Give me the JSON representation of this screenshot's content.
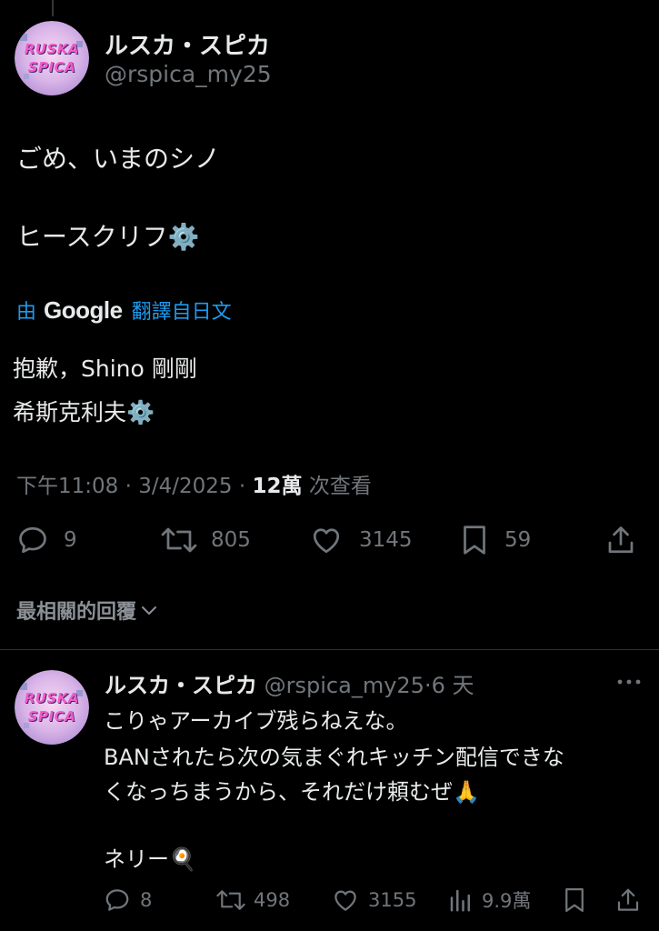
{
  "main_tweet": {
    "display_name": "ルスカ・スピカ",
    "handle": "@rspica_my25",
    "avatar_text": [
      "RUSKA",
      "SPICA"
    ],
    "text_line1": "ごめ、いまのシノ",
    "text_line2": "ヒースクリフ⚙️",
    "translate_prefix": "由",
    "translate_brand": "Google",
    "translate_suffix": "翻譯自日文",
    "translated_line1": "抱歉，Shino 剛剛",
    "translated_line2": "希斯克利夫⚙️",
    "time": "下午11:08",
    "date": "3/4/2025",
    "views_count": "12萬",
    "views_label": "次查看",
    "sep": "·",
    "replies": "9",
    "retweets": "805",
    "likes": "3145",
    "bookmarks": "59"
  },
  "sort_label": "最相關的回覆",
  "reply": {
    "display_name": "ルスカ・スピカ",
    "handle": "@rspica_my25",
    "time": "6 天",
    "sep": "·",
    "text_line1": "こりゃアーカイブ残らねえな。",
    "text_line2": "BANされたら次の気まぐれキッチン配信できな",
    "text_line3": "くなっちまうから、それだけ頼むぜ🙏",
    "text_line4": "ネリー🍳",
    "replies": "8",
    "retweets": "498",
    "likes": "3155",
    "views": "9.9萬"
  },
  "colors": {
    "background": "#000000",
    "text": "#e7e9ea",
    "muted": "#71767b",
    "link": "#1d9bf0",
    "divider": "#2f3336"
  }
}
